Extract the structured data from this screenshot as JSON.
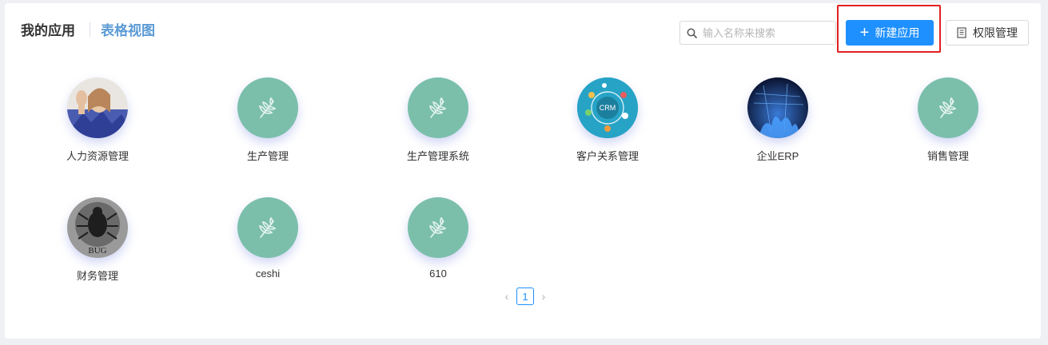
{
  "header": {
    "title": "我的应用",
    "view_link": "表格视图"
  },
  "search": {
    "placeholder": "输入名称来搜索",
    "value": ""
  },
  "actions": {
    "new_app_label": "新建应用",
    "permission_label": "权限管理"
  },
  "apps": [
    {
      "label": "人力资源管理",
      "icon": "photo-person-avatar"
    },
    {
      "label": "生产管理",
      "icon": "wheat-icon"
    },
    {
      "label": "生产管理系统",
      "icon": "wheat-icon"
    },
    {
      "label": "客户关系管理",
      "icon": "crm-avatar",
      "avatar_text": "CRM"
    },
    {
      "label": "企业ERP",
      "icon": "network-photo-avatar"
    },
    {
      "label": "销售管理",
      "icon": "wheat-icon"
    },
    {
      "label": "财务管理",
      "icon": "bug-avatar",
      "avatar_text": "BUG"
    },
    {
      "label": "ceshi",
      "icon": "wheat-icon"
    },
    {
      "label": "610",
      "icon": "wheat-icon"
    }
  ],
  "pagination": {
    "current": "1",
    "prev": "‹",
    "next": "›"
  },
  "colors": {
    "primary": "#1e90ff",
    "link": "#5b9bd5",
    "default_app_icon_bg": "#7bbfab",
    "highlight_border": "#e02020"
  }
}
